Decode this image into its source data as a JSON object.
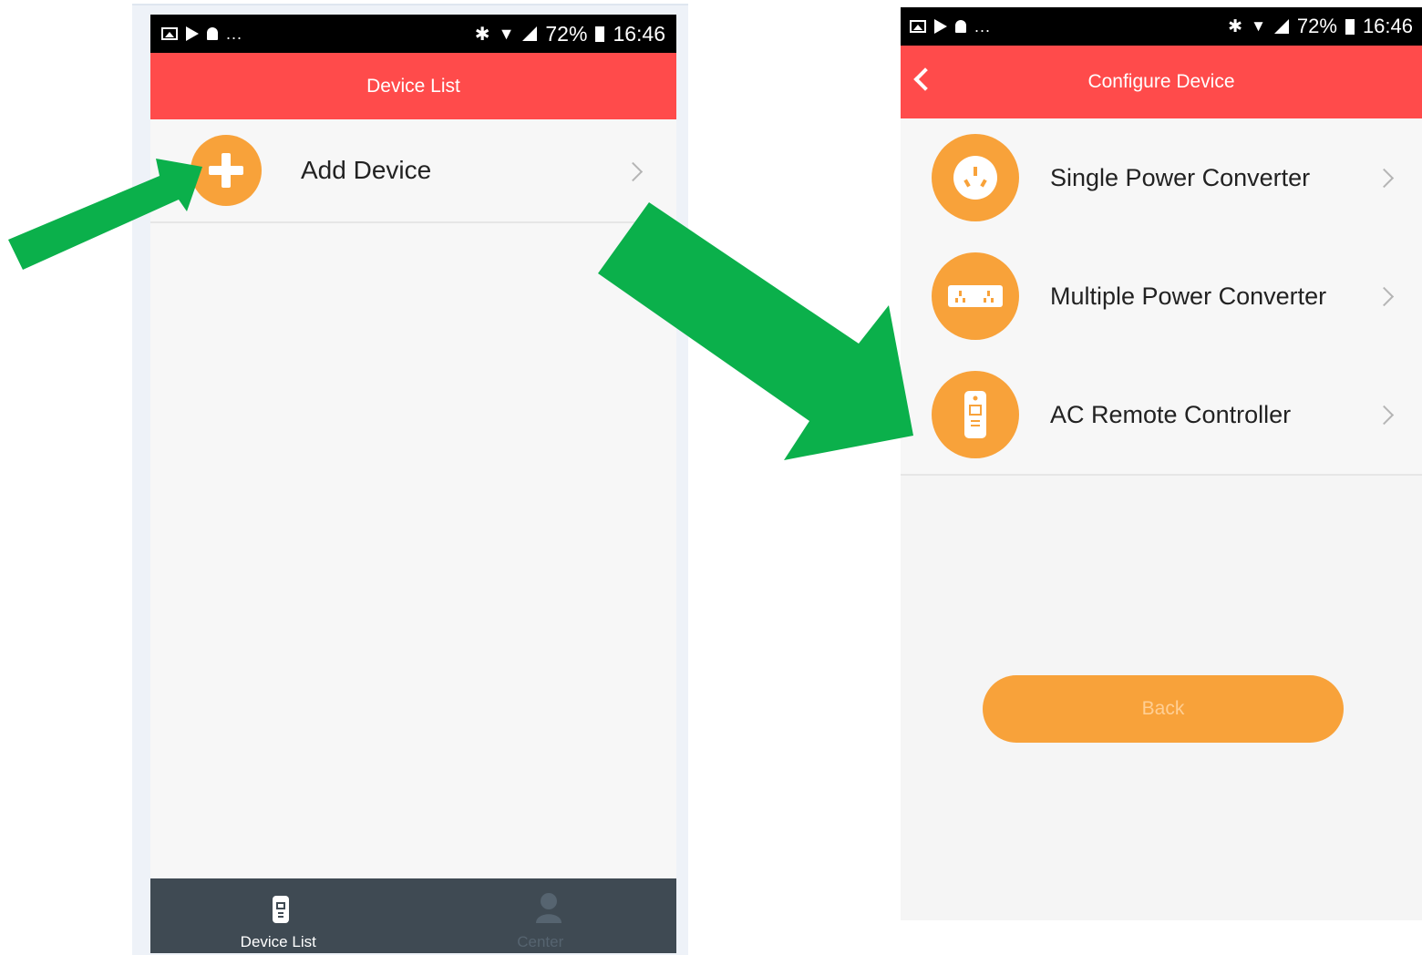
{
  "status_bar": {
    "battery": "72%",
    "time": "16:46",
    "more": "..."
  },
  "left_screen": {
    "title": "Device List",
    "add_device_label": "Add Device",
    "tabs": [
      {
        "label": "Device List",
        "active": true
      },
      {
        "label": "Center",
        "active": false
      }
    ]
  },
  "right_screen": {
    "title": "Configure Device",
    "items": [
      {
        "label": "Single Power Converter",
        "icon": "single-socket-icon"
      },
      {
        "label": "Multiple Power Converter",
        "icon": "multi-socket-icon"
      },
      {
        "label": "AC Remote Controller",
        "icon": "remote-icon"
      }
    ],
    "back_label": "Back"
  },
  "colors": {
    "header_red": "#ff4b4b",
    "accent_orange": "#f8a23a",
    "annotation_green": "#0bb04b",
    "tabbar": "#3f4a53"
  }
}
